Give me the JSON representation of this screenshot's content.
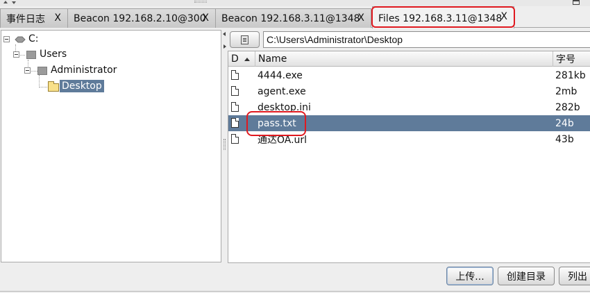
{
  "tabs": [
    {
      "label": "事件日志",
      "close": "X"
    },
    {
      "label": "Beacon 192.168.2.10@300",
      "close": "X"
    },
    {
      "label": "Beacon 192.168.3.11@1348",
      "close": "X"
    },
    {
      "label": "Files 192.168.3.11@1348",
      "close": "X",
      "active": true
    }
  ],
  "tree": {
    "root": "C:",
    "users": "Users",
    "administrator": "Administrator",
    "desktop": "Desktop"
  },
  "path": {
    "value": "C:\\Users\\Administrator\\Desktop"
  },
  "table": {
    "headers": {
      "d": "D",
      "name": "Name",
      "size": "字号"
    },
    "sort": "ascending",
    "rows": [
      {
        "name": "4444.exe",
        "size": "281kb",
        "icon": "file-icon"
      },
      {
        "name": "agent.exe",
        "size": "2mb",
        "icon": "file-icon"
      },
      {
        "name": "desktop.ini",
        "size": "282b",
        "icon": "file-icon"
      },
      {
        "name": "pass.txt",
        "size": "24b",
        "icon": "file-icon",
        "selected": true
      },
      {
        "name": "通达OA.url",
        "size": "43b",
        "icon": "file-icon"
      }
    ]
  },
  "buttons": {
    "upload": "上传...",
    "mkdir": "创建目录",
    "list": "列出"
  },
  "colors": {
    "selection": "#5f7b9a",
    "highlight": "#e0191f"
  }
}
